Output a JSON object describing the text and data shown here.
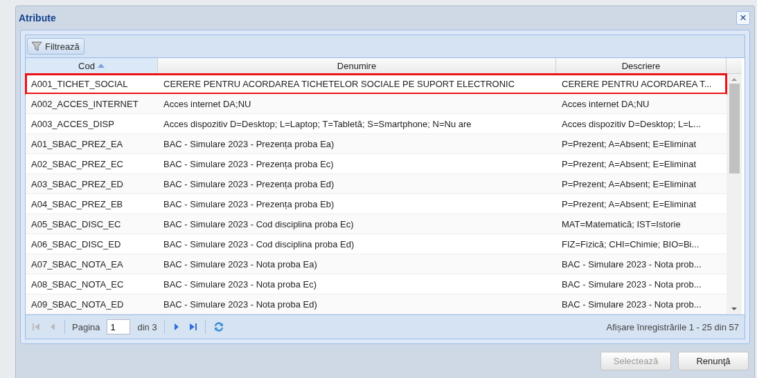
{
  "window": {
    "title": "Atribute",
    "close": "×"
  },
  "toolbar": {
    "filter_button": "Filtrează"
  },
  "table": {
    "columns": [
      {
        "label": "Cod",
        "sorted": true
      },
      {
        "label": "Denumire",
        "sorted": false
      },
      {
        "label": "Descriere",
        "sorted": false
      }
    ],
    "rows": [
      {
        "cells": [
          "A001_TICHET_SOCIAL",
          "CERERE PENTRU ACORDAREA TICHETELOR SOCIALE PE SUPORT ELECTRONIC",
          "CERERE PENTRU ACORDAREA T..."
        ],
        "highlighted": true
      },
      {
        "cells": [
          "A002_ACCES_INTERNET",
          "Acces internet DA;NU",
          "Acces internet DA;NU"
        ],
        "highlighted": false
      },
      {
        "cells": [
          "A003_ACCES_DISP",
          "Acces dispozitiv D=Desktop; L=Laptop; T=Tabletă; S=Smartphone; N=Nu are",
          "Acces dispozitiv D=Desktop; L=L..."
        ],
        "highlighted": false
      },
      {
        "cells": [
          "A01_SBAC_PREZ_EA",
          "BAC - Simulare 2023 - Prezența proba Ea)",
          "P=Prezent; A=Absent; E=Eliminat"
        ],
        "highlighted": false
      },
      {
        "cells": [
          "A02_SBAC_PREZ_EC",
          "BAC - Simulare 2023 - Prezența proba Ec)",
          "P=Prezent; A=Absent; E=Eliminat"
        ],
        "highlighted": false
      },
      {
        "cells": [
          "A03_SBAC_PREZ_ED",
          "BAC - Simulare 2023 - Prezența proba Ed)",
          "P=Prezent; A=Absent; E=Eliminat"
        ],
        "highlighted": false
      },
      {
        "cells": [
          "A04_SBAC_PREZ_EB",
          "BAC - Simulare 2023 - Prezența proba Eb)",
          "P=Prezent; A=Absent; E=Eliminat"
        ],
        "highlighted": false
      },
      {
        "cells": [
          "A05_SBAC_DISC_EC",
          "BAC - Simulare 2023 - Cod disciplina proba Ec)",
          "MAT=Matematică; IST=Istorie"
        ],
        "highlighted": false
      },
      {
        "cells": [
          "A06_SBAC_DISC_ED",
          "BAC - Simulare 2023 - Cod disciplina proba Ed)",
          "FIZ=Fizică; CHI=Chimie; BIO=Bi..."
        ],
        "highlighted": false
      },
      {
        "cells": [
          "A07_SBAC_NOTA_EA",
          "BAC - Simulare 2023 - Nota proba Ea)",
          "BAC - Simulare 2023 - Nota prob..."
        ],
        "highlighted": false
      },
      {
        "cells": [
          "A08_SBAC_NOTA_EC",
          "BAC - Simulare 2023 - Nota proba Ec)",
          "BAC - Simulare 2023 - Nota prob..."
        ],
        "highlighted": false
      },
      {
        "cells": [
          "A09_SBAC_NOTA_ED",
          "BAC - Simulare 2023 - Nota proba Ed)",
          "BAC - Simulare 2023 - Nota prob..."
        ],
        "highlighted": false
      }
    ]
  },
  "pager": {
    "page_label": "Pagina",
    "page_value": "1",
    "page_total": "din 3",
    "summary": "Afișare înregistrările 1 - 25 din 57"
  },
  "buttons": [
    {
      "label": "Selectează",
      "disabled": true
    },
    {
      "label": "Renunţă",
      "disabled": false
    }
  ]
}
